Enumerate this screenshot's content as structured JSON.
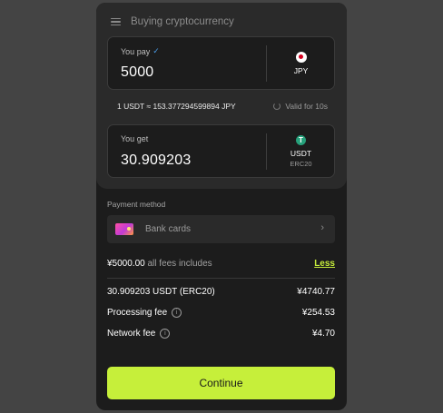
{
  "header": {
    "title": "Buying cryptocurrency",
    "menu_icon": "menu-icon"
  },
  "pay": {
    "label": "You pay",
    "value": "5000",
    "currency": "JPY",
    "icon": "flag-japan-icon"
  },
  "rate": {
    "text": "1 USDT ≈ 153.377294599894 JPY",
    "valid": "Valid for 10s"
  },
  "get": {
    "label": "You get",
    "value": "30.909203",
    "currency": "USDT",
    "network": "ERC20",
    "icon": "tether-icon",
    "icon_glyph": "T"
  },
  "payment": {
    "label": "Payment method",
    "method": "Bank cards",
    "chevron": "›"
  },
  "summary": {
    "total_amount": "¥5000.00",
    "total_note": "all fees includes",
    "toggle": "Less",
    "rows": [
      {
        "label": "30.909203 USDT (ERC20)",
        "value": "¥4740.77"
      },
      {
        "label": "Processing fee",
        "value": "¥254.53"
      },
      {
        "label": "Network fee",
        "value": "¥4.70"
      }
    ],
    "info_glyph": "i"
  },
  "continue_label": "Continue",
  "colors": {
    "accent": "#c6ef3a",
    "panel": "#2a2a2a",
    "background": "#1c1c1c",
    "page": "#444444"
  }
}
